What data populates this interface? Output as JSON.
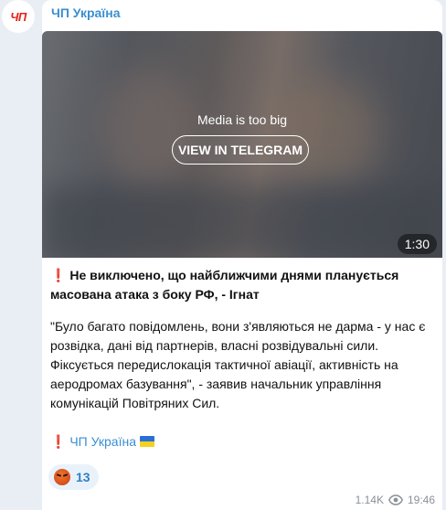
{
  "channel": {
    "avatar_text": "ЧП",
    "name": "ЧП Україна"
  },
  "media": {
    "notice": "Media is too big",
    "button_label": "VIEW IN TELEGRAM",
    "duration": "1:30"
  },
  "post": {
    "headline_mark": "❗",
    "headline": "Не виключено, що найближчими днями планується масована атака з боку РФ, - Ігнат",
    "quote": "\"Було багато повідомлень, вони з'являються не дарма - у нас є розвідка, дані від партнерів, власні розвідувальні сили. Фіксується передислокація тактичної авіації, активність на аеродромах базування\", - заявив начальник управління комунікацій Повітряних Сил.",
    "footer_mark": "❗",
    "footer_channel": "ЧП Україна"
  },
  "reaction": {
    "emoji_name": "angry-face",
    "count": "13"
  },
  "meta": {
    "views": "1.14K",
    "time": "19:46"
  },
  "colors": {
    "accent": "#3a8fd1",
    "avatar_red": "#e3231c",
    "background": "#e8eef3"
  }
}
